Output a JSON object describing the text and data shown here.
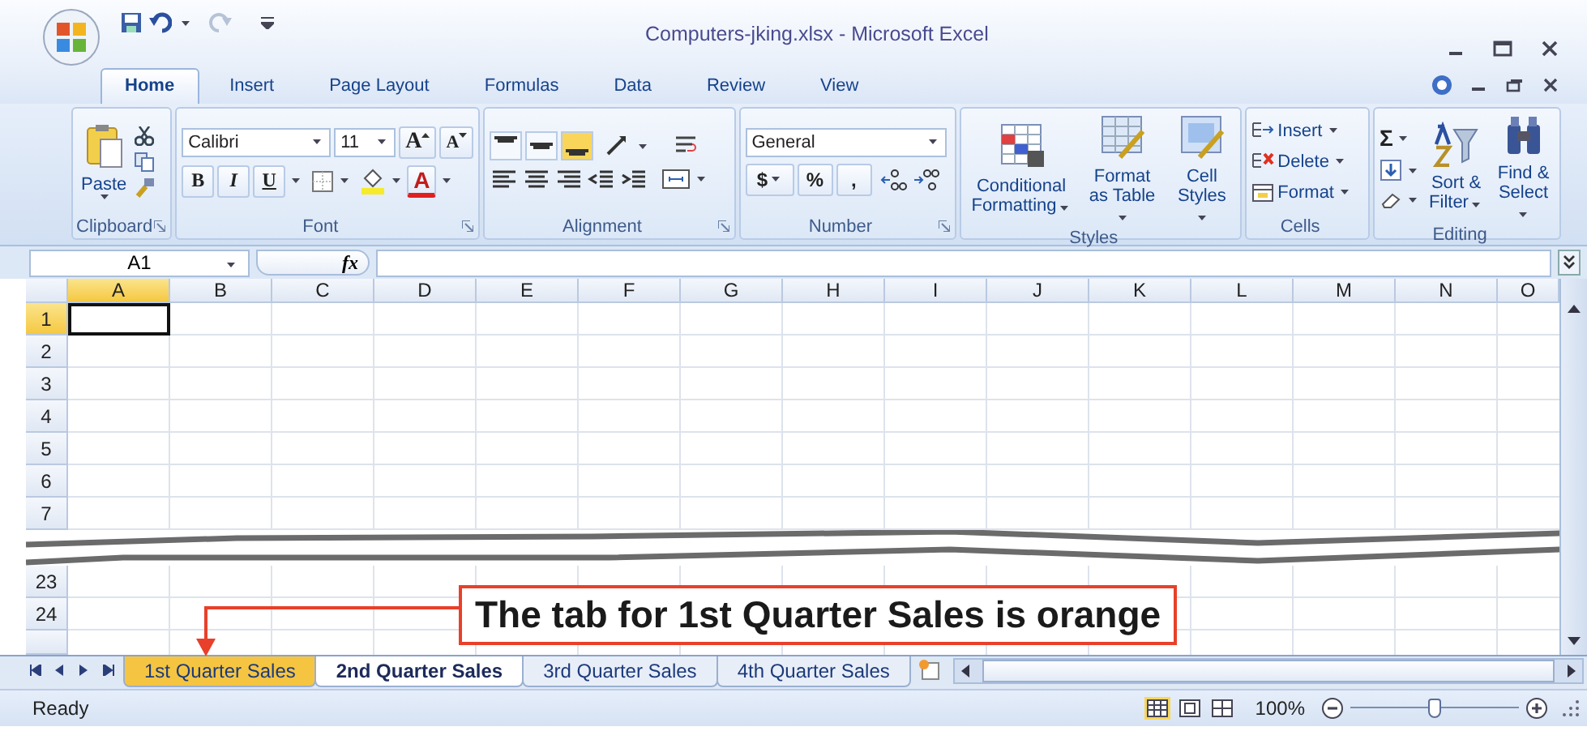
{
  "window": {
    "title": "Computers-jking.xlsx - Microsoft Excel"
  },
  "ribbon_tabs": [
    {
      "label": "Home",
      "selected": true
    },
    {
      "label": "Insert",
      "selected": false
    },
    {
      "label": "Page Layout",
      "selected": false
    },
    {
      "label": "Formulas",
      "selected": false
    },
    {
      "label": "Data",
      "selected": false
    },
    {
      "label": "Review",
      "selected": false
    },
    {
      "label": "View",
      "selected": false
    }
  ],
  "ribbon": {
    "clipboard": {
      "label": "Clipboard",
      "paste": "Paste"
    },
    "font": {
      "label": "Font",
      "name": "Calibri",
      "size": "11",
      "size_buttons": [
        "A",
        "A"
      ],
      "styles": [
        "B",
        "I",
        "U"
      ],
      "color_letter": "A"
    },
    "alignment": {
      "label": "Alignment",
      "vertical": [
        {
          "kind": "top",
          "selected": false
        },
        {
          "kind": "middle",
          "selected": false
        },
        {
          "kind": "bottom",
          "selected": true
        }
      ]
    },
    "number": {
      "label": "Number",
      "format": "General",
      "symbols": [
        "$",
        "%",
        ","
      ]
    },
    "styles": {
      "label": "Styles",
      "commands": [
        "Conditional Formatting",
        "Format as Table",
        "Cell Styles"
      ]
    },
    "cells": {
      "label": "Cells",
      "commands": [
        "Insert",
        "Delete",
        "Format"
      ]
    },
    "editing": {
      "label": "Editing",
      "sum": "Σ",
      "commands": [
        "Sort & Filter",
        "Find & Select"
      ]
    }
  },
  "formula_bar": {
    "name_box": "A1",
    "function_label": "fx"
  },
  "sheet": {
    "columns": [
      {
        "label": "A",
        "selected": true
      },
      {
        "label": "B",
        "selected": false
      },
      {
        "label": "C",
        "selected": false
      },
      {
        "label": "D",
        "selected": false
      },
      {
        "label": "E",
        "selected": false
      },
      {
        "label": "F",
        "selected": false
      },
      {
        "label": "G",
        "selected": false
      },
      {
        "label": "H",
        "selected": false
      },
      {
        "label": "I",
        "selected": false
      },
      {
        "label": "J",
        "selected": false
      },
      {
        "label": "K",
        "selected": false
      },
      {
        "label": "L",
        "selected": false
      },
      {
        "label": "M",
        "selected": false
      },
      {
        "label": "N",
        "selected": false
      },
      {
        "label": "O",
        "selected": false
      }
    ],
    "rows": [
      {
        "label": "1",
        "selected": true
      },
      {
        "label": "2",
        "selected": false
      },
      {
        "label": "3",
        "selected": false
      },
      {
        "label": "4",
        "selected": false
      },
      {
        "label": "5",
        "selected": false
      },
      {
        "label": "6",
        "selected": false
      },
      {
        "label": "7",
        "selected": false
      }
    ],
    "rows_after_break": [
      {
        "label": "23",
        "selected": false
      },
      {
        "label": "24",
        "selected": false
      }
    ]
  },
  "sheet_tabs": [
    {
      "label": "1st Quarter Sales",
      "selected": false,
      "color": "#f5c542"
    },
    {
      "label": "2nd Quarter Sales",
      "selected": true
    },
    {
      "label": "3rd Quarter Sales",
      "selected": false
    },
    {
      "label": "4th Quarter Sales",
      "selected": false
    }
  ],
  "callout": {
    "text": "The tab for 1st Quarter Sales is orange"
  },
  "status_bar": {
    "status": "Ready",
    "zoom": "100%",
    "zoom_slider": {
      "level": 0.5
    }
  }
}
